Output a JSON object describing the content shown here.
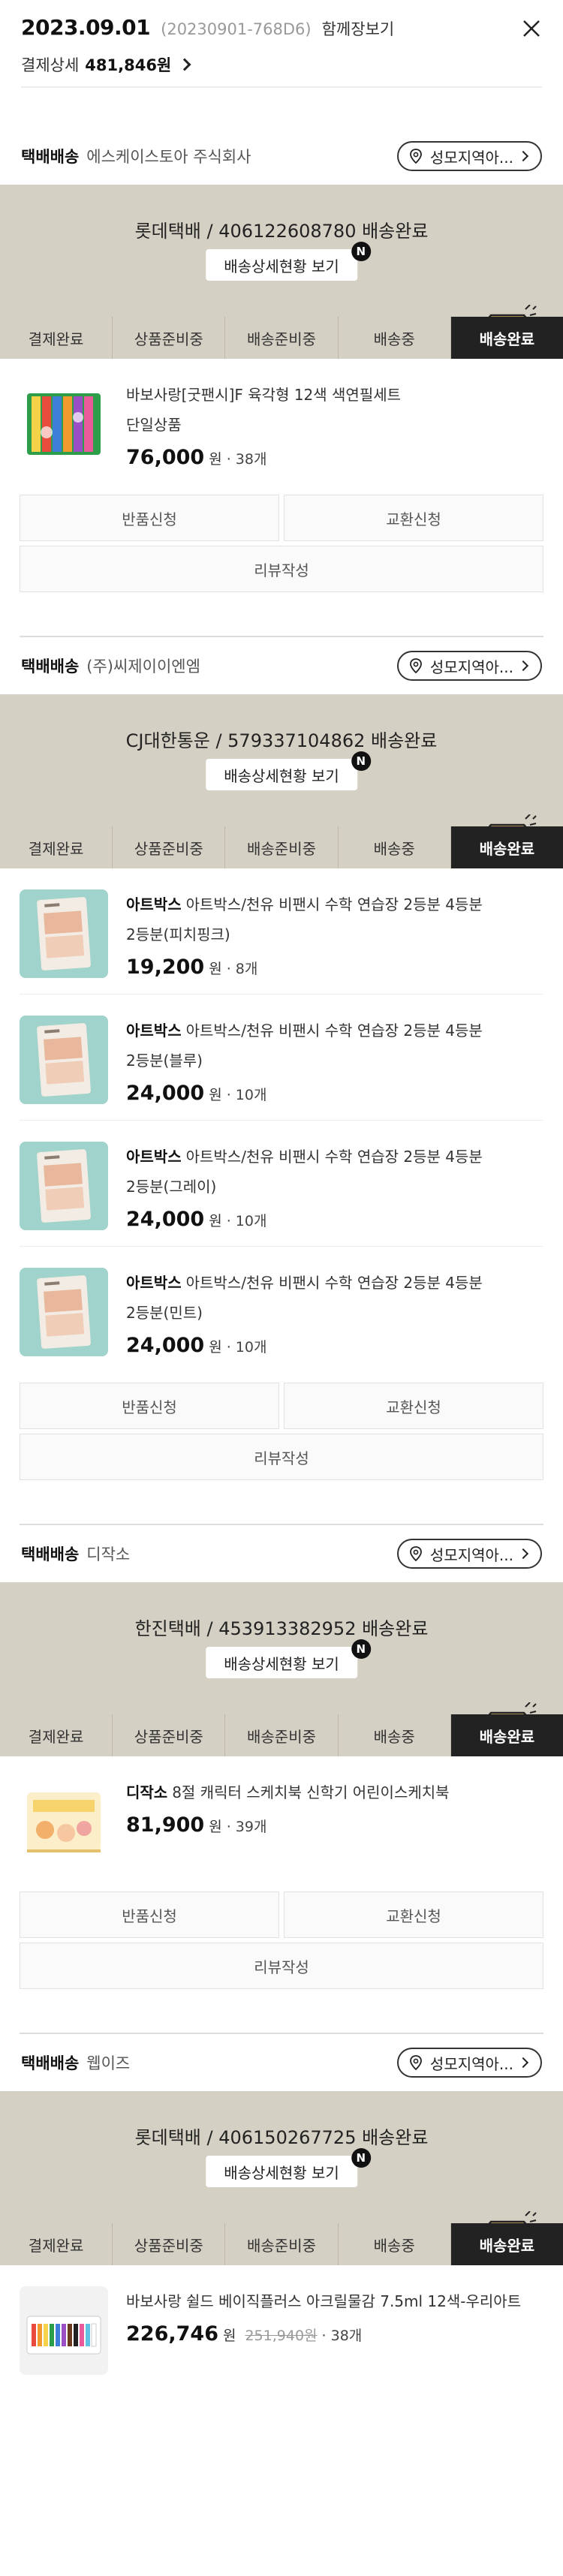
{
  "header": {
    "order_date": "2023.09.01",
    "order_number": "(20230901-768D6)",
    "together_view": "함께장보기",
    "payment_label": "결제상세",
    "payment_amount": "481,846원"
  },
  "common": {
    "delivery_tag": "택배배송",
    "store_button": "성모지역아...",
    "track_button": "배송상세현황 보기",
    "new_badge": "N",
    "steps": [
      "결제완료",
      "상품준비중",
      "배송준비중",
      "배송중",
      "배송완료"
    ],
    "active_step_index": 4,
    "return_label": "반품신청",
    "exchange_label": "교환신청",
    "review_label": "리뷰작성",
    "won_unit": "원",
    "qty_sep": "·"
  },
  "shipments": [
    {
      "seller": "에스케이스토아 주식회사",
      "tracking": "롯데택배 / 406122608780 배송완료",
      "items": [
        {
          "brand": "",
          "title": "바보사랑[굿팬시]F 육각형 12색 색연필세트",
          "option": "단일상품",
          "price": "76,000",
          "original_price": "",
          "qty": "38개",
          "thumb": "pencils"
        }
      ],
      "show_actions": true
    },
    {
      "seller": "(주)씨제이이엔엠",
      "tracking": "CJ대한통운 / 579337104862 배송완료",
      "items": [
        {
          "brand": "아트박스",
          "title": "아트박스/천유 비팬시 수학 연습장 2등분 4등분",
          "option": "2등분(피치핑크)",
          "price": "19,200",
          "original_price": "",
          "qty": "8개",
          "thumb": "notebook"
        },
        {
          "brand": "아트박스",
          "title": "아트박스/천유 비팬시 수학 연습장 2등분 4등분",
          "option": "2등분(블루)",
          "price": "24,000",
          "original_price": "",
          "qty": "10개",
          "thumb": "notebook"
        },
        {
          "brand": "아트박스",
          "title": "아트박스/천유 비팬시 수학 연습장 2등분 4등분",
          "option": "2등분(그레이)",
          "price": "24,000",
          "original_price": "",
          "qty": "10개",
          "thumb": "notebook"
        },
        {
          "brand": "아트박스",
          "title": "아트박스/천유 비팬시 수학 연습장 2등분 4등분",
          "option": "2등분(민트)",
          "price": "24,000",
          "original_price": "",
          "qty": "10개",
          "thumb": "notebook"
        }
      ],
      "show_actions": true
    },
    {
      "seller": "디작소",
      "tracking": "한진택배 / 453913382952 배송완료",
      "items": [
        {
          "brand": "디작소",
          "title": "8절 캐릭터 스케치북 신학기 어린이스케치북",
          "option": "",
          "price": "81,900",
          "original_price": "",
          "qty": "39개",
          "thumb": "sketchbook"
        }
      ],
      "show_actions": true
    },
    {
      "seller": "웹이즈",
      "tracking": "롯데택배 / 406150267725 배송완료",
      "items": [
        {
          "brand": "",
          "title": "바보사랑 쉴드 베이직플러스 아크릴물감 7.5ml 12색-우리아트",
          "option": "",
          "price": "226,746",
          "original_price": "251,940원",
          "qty": "38개",
          "thumb": "paint"
        }
      ],
      "show_actions": false
    }
  ]
}
